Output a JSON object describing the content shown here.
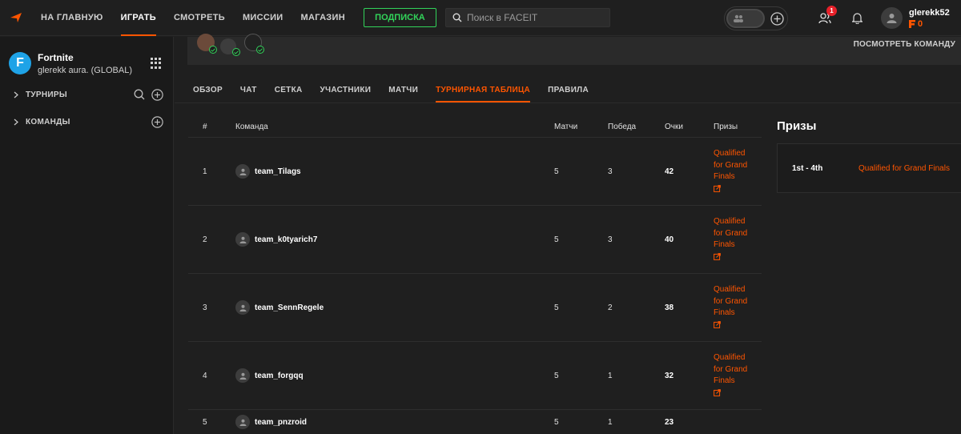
{
  "topbar": {
    "nav": [
      "НА ГЛАВНУЮ",
      "ИГРАТЬ",
      "СМОТРЕТЬ",
      "МИССИИ",
      "МАГАЗИН"
    ],
    "active_nav": "ИГРАТЬ",
    "subscribe_label": "ПОДПИСКА",
    "search_placeholder": "Поиск в FACEIT",
    "friends_badge": "1",
    "username": "glerekk52",
    "points": "0",
    "colors": {
      "accent": "#ff5500",
      "subscribe": "#32d35a",
      "badge": "#e8212a"
    }
  },
  "sidebar": {
    "game_name": "Fortnite",
    "game_sub": "glerekk aura. (GLOBAL)",
    "items": [
      {
        "label": "ТУРНИРЫ"
      },
      {
        "label": "КОМАНДЫ"
      }
    ]
  },
  "main": {
    "view_team": "ПОСМОТРЕТЬ КОМАНДУ",
    "tabs": [
      {
        "label": "ОБЗОР"
      },
      {
        "label": "ЧАТ"
      },
      {
        "label": "СЕТКА"
      },
      {
        "label": "УЧАСТНИКИ"
      },
      {
        "label": "МАТЧИ"
      },
      {
        "label": "ТУРНИРНАЯ ТАБЛИЦА"
      },
      {
        "label": "ПРАВИЛА"
      }
    ],
    "active_tab": "ТУРНИРНАЯ ТАБЛИЦА",
    "table": {
      "headers": {
        "num": "#",
        "team": "Команда",
        "matches": "Матчи",
        "wins": "Победа",
        "points": "Очки",
        "prizes": "Призы"
      },
      "rows": [
        {
          "num": "1",
          "team": "team_Tilags",
          "matches": "5",
          "wins": "3",
          "points": "42",
          "prize": "Qualified for Grand Finals"
        },
        {
          "num": "2",
          "team": "team_k0tyarich7",
          "matches": "5",
          "wins": "3",
          "points": "40",
          "prize": "Qualified for Grand Finals"
        },
        {
          "num": "3",
          "team": "team_SennRegele",
          "matches": "5",
          "wins": "2",
          "points": "38",
          "prize": "Qualified for Grand Finals"
        },
        {
          "num": "4",
          "team": "team_forgqq",
          "matches": "5",
          "wins": "1",
          "points": "32",
          "prize": "Qualified for Grand Finals"
        },
        {
          "num": "5",
          "team": "team_pnzroid",
          "matches": "5",
          "wins": "1",
          "points": "23",
          "prize": ""
        }
      ]
    },
    "prizes": {
      "title": "Призы",
      "items": [
        {
          "place": "1st - 4th",
          "value": "Qualified for Grand Finals"
        }
      ]
    }
  }
}
